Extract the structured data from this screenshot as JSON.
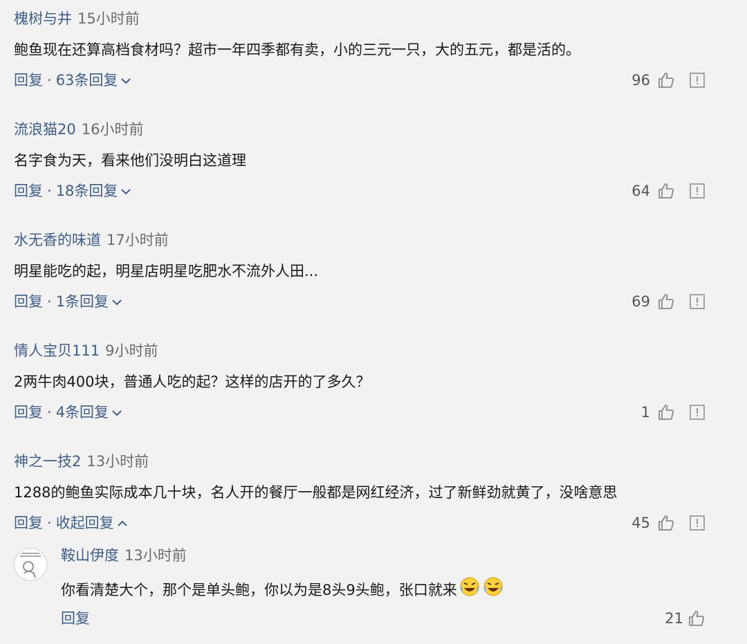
{
  "comments": [
    {
      "user": "槐树与井",
      "time": "15小时前",
      "text": "鲍鱼现在还算高档食材吗？超市一年四季都有卖，小的三元一只，大的五元，都是活的。",
      "reply_label": "回复",
      "sep": "·",
      "replies_label": "63条回复",
      "likes": "96"
    },
    {
      "user": "流浪猫20",
      "time": "16小时前",
      "text": "名字食为天，看来他们没明白这道理",
      "reply_label": "回复",
      "sep": "·",
      "replies_label": "18条回复",
      "likes": "64"
    },
    {
      "user": "水无香的味道",
      "time": "17小时前",
      "text": "明星能吃的起，明星店明星吃肥水不流外人田...",
      "reply_label": "回复",
      "sep": "·",
      "replies_label": "1条回复",
      "likes": "69"
    },
    {
      "user": "情人宝贝111",
      "time": "9小时前",
      "text": "2两牛肉400块，普通人吃的起？这样的店开的了多久？",
      "reply_label": "回复",
      "sep": "·",
      "replies_label": "4条回复",
      "likes": "1"
    },
    {
      "user": "神之一技2",
      "time": "13小时前",
      "text": "1288的鲍鱼实际成本几十块，名人开的餐厅一般都是网红经济，过了新鲜劲就黄了，没啥意思",
      "reply_label": "回复",
      "sep": "·",
      "replies_label": "收起回复",
      "likes": "45"
    }
  ],
  "sub_reply": {
    "user": "鞍山伊度",
    "time": "13小时前",
    "text": "你看清楚大个，那个是单头鲍，你以为是8头9头鲍，张口就来",
    "reply_label": "回复",
    "likes": "21"
  },
  "icons": {
    "thumb": "thumbs-up-icon",
    "report": "report-icon",
    "chevron_down": "chevron-down-icon",
    "chevron_up": "chevron-up-icon",
    "emoji": "crying-laughing-emoji"
  },
  "colors": {
    "link": "#3f5e8a",
    "background": "#f2f2f2",
    "text": "#1a1a1a",
    "muted": "#6b6b6b"
  }
}
